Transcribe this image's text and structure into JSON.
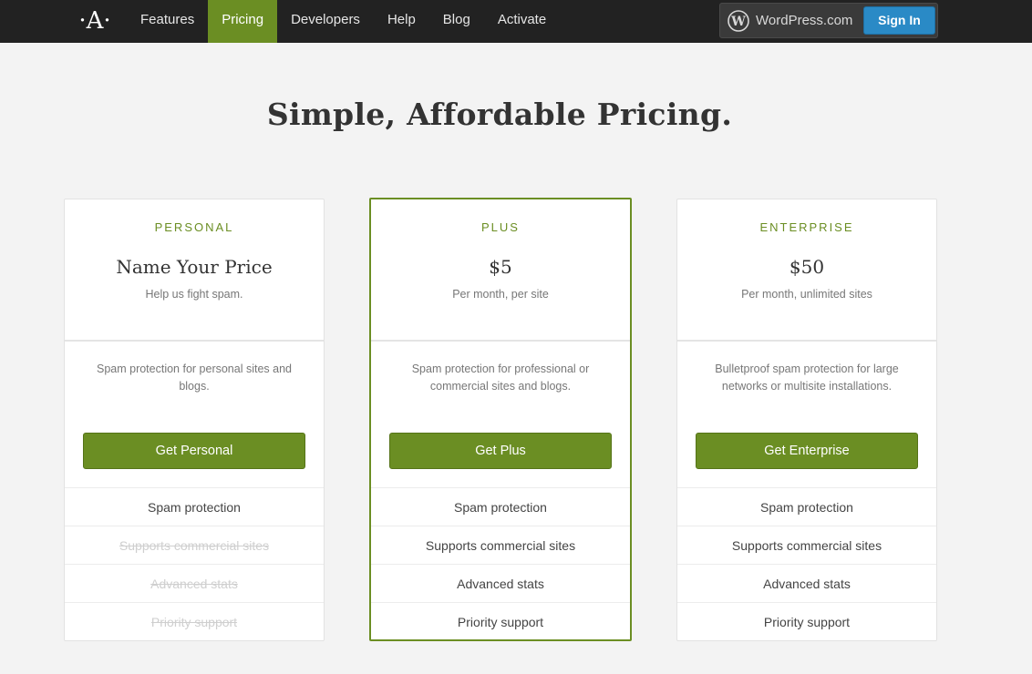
{
  "nav": {
    "logo": "·A·",
    "items": [
      {
        "label": "Features",
        "active": false
      },
      {
        "label": "Pricing",
        "active": true
      },
      {
        "label": "Developers",
        "active": false
      },
      {
        "label": "Help",
        "active": false
      },
      {
        "label": "Blog",
        "active": false
      },
      {
        "label": "Activate",
        "active": false
      }
    ],
    "wordpress_label": "WordPress.com",
    "signin_label": "Sign In"
  },
  "page": {
    "title": "Simple, Affordable Pricing."
  },
  "plans": [
    {
      "name": "PERSONAL",
      "price": "Name Your Price",
      "sub": "Help us fight spam.",
      "description": "Spam protection for personal sites and blogs.",
      "button": "Get Personal",
      "features": [
        {
          "label": "Spam protection",
          "included": true
        },
        {
          "label": "Supports commercial sites",
          "included": false
        },
        {
          "label": "Advanced stats",
          "included": false
        },
        {
          "label": "Priority support",
          "included": false
        }
      ]
    },
    {
      "name": "PLUS",
      "price": "$5",
      "sub": "Per month, per site",
      "description": "Spam protection for professional or commercial sites and blogs.",
      "button": "Get Plus",
      "featured": true,
      "features": [
        {
          "label": "Spam protection",
          "included": true
        },
        {
          "label": "Supports commercial sites",
          "included": true
        },
        {
          "label": "Advanced stats",
          "included": true
        },
        {
          "label": "Priority support",
          "included": true
        }
      ]
    },
    {
      "name": "ENTERPRISE",
      "price": "$50",
      "sub": "Per month, unlimited sites",
      "description": "Bulletproof spam protection for large networks or multisite installations.",
      "button": "Get Enterprise",
      "features": [
        {
          "label": "Spam protection",
          "included": true
        },
        {
          "label": "Supports commercial sites",
          "included": true
        },
        {
          "label": "Advanced stats",
          "included": true
        },
        {
          "label": "Priority support",
          "included": true
        }
      ]
    }
  ],
  "colors": {
    "accent": "#6b8e23",
    "topbar": "#222222",
    "signin": "#2a8ac6"
  }
}
